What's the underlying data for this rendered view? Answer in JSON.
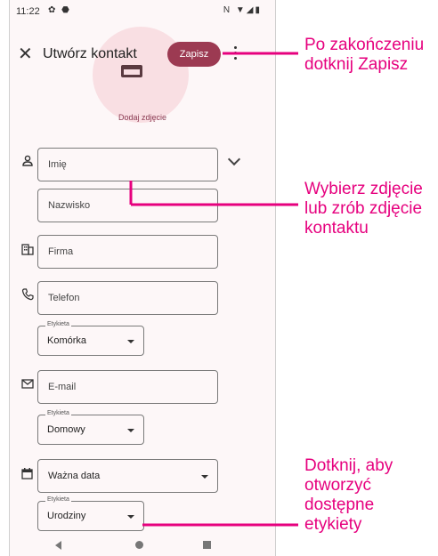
{
  "status": {
    "time": "11:22",
    "left_icons": "✿ ⬣",
    "right_icons": "N ▼◢▮"
  },
  "appbar": {
    "title": "Utwórz kontakt",
    "save_label": "Zapisz"
  },
  "photo": {
    "add_label": "Dodaj zdjęcie"
  },
  "form": {
    "first_name_placeholder": "Imię",
    "last_name_placeholder": "Nazwisko",
    "company_placeholder": "Firma",
    "phone_placeholder": "Telefon",
    "phone_label_legend": "Etykieta",
    "phone_label_value": "Komórka",
    "email_placeholder": "E-mail",
    "email_label_legend": "Etykieta",
    "email_label_value": "Domowy",
    "date_value": "Ważna data",
    "date_label_legend": "Etykieta",
    "date_label_value": "Urodziny"
  },
  "icons": {
    "close": "close-icon",
    "more": "more-vert-icon",
    "person": "person-icon",
    "company": "business-icon",
    "phone": "phone-icon",
    "email": "mail-icon",
    "date": "calendar-icon"
  },
  "callouts": {
    "save": [
      "Po zakończeniu",
      "dotknij Zapisz"
    ],
    "photo": [
      "Wybierz zdjęcie",
      "lub zrób zdjęcie",
      "kontaktu"
    ],
    "labels": [
      "Dotknij, aby",
      "otworzyć",
      "dostępne",
      "etykiety"
    ]
  },
  "colors": {
    "accent": "#9c3a52",
    "callout": "#e6007e",
    "background": "#fdf7f8"
  }
}
